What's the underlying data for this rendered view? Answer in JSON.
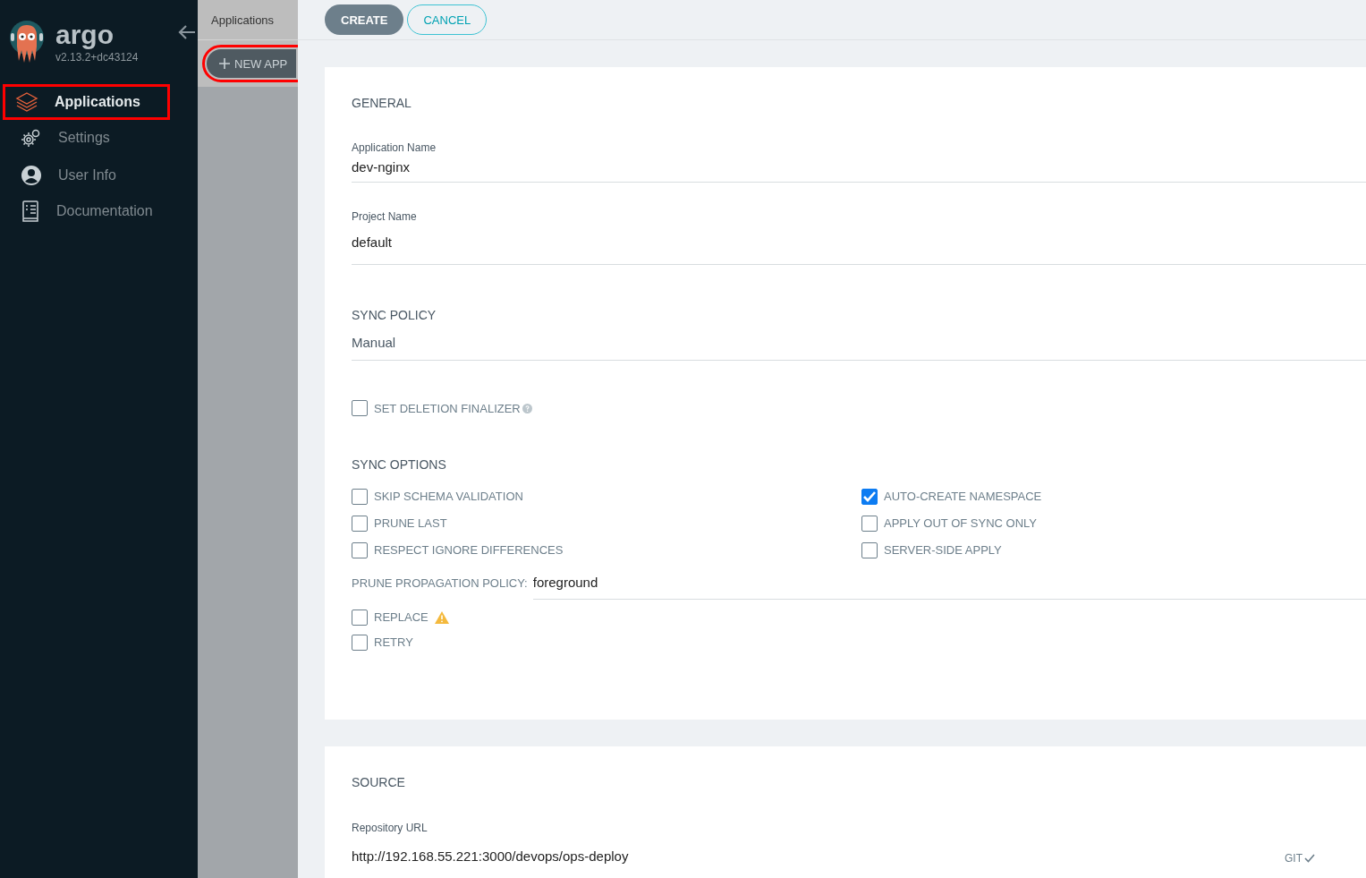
{
  "sidebar": {
    "logo_text": "argo",
    "version": "v2.13.2+dc43124",
    "items": [
      {
        "label": "Applications",
        "selected": true,
        "highlighted": true
      },
      {
        "label": "Settings",
        "selected": false,
        "highlighted": false
      },
      {
        "label": "User Info",
        "selected": false,
        "highlighted": false
      },
      {
        "label": "Documentation",
        "selected": false,
        "highlighted": false
      }
    ]
  },
  "breadcrumb": "Applications",
  "new_app_button": {
    "label": "NEW APP",
    "highlighted": true
  },
  "toolbar": {
    "buttons": [
      {
        "label": "CREATE",
        "kind": "primary"
      },
      {
        "label": "CANCEL",
        "kind": "outline"
      }
    ]
  },
  "general": {
    "title": "GENERAL",
    "fields": [
      {
        "label": "Application Name",
        "value": "dev-nginx"
      },
      {
        "label": "Project Name",
        "value": "default"
      }
    ],
    "sync_policy": {
      "title": "SYNC POLICY",
      "value": "Manual"
    },
    "deletion_finalizer": {
      "label": "SET DELETION FINALIZER",
      "checked": false
    },
    "sync_options": {
      "title": "SYNC OPTIONS",
      "left": [
        {
          "label": "SKIP SCHEMA VALIDATION",
          "checked": false
        },
        {
          "label": "PRUNE LAST",
          "checked": false
        },
        {
          "label": "RESPECT IGNORE DIFFERENCES",
          "checked": false
        }
      ],
      "right": [
        {
          "label": "AUTO-CREATE NAMESPACE",
          "checked": true
        },
        {
          "label": "APPLY OUT OF SYNC ONLY",
          "checked": false
        },
        {
          "label": "SERVER-SIDE APPLY",
          "checked": false
        }
      ]
    },
    "prune_policy": {
      "label": "PRUNE PROPAGATION POLICY:",
      "value": "foreground"
    },
    "extra_options": [
      {
        "label": "REPLACE",
        "checked": false,
        "warning": true
      },
      {
        "label": "RETRY",
        "checked": false,
        "warning": false
      }
    ]
  },
  "source": {
    "title": "SOURCE",
    "field": {
      "label": "Repository URL",
      "value": "http://192.168.55.221:3000/devops/ops-deploy",
      "suffix": "GIT"
    }
  }
}
